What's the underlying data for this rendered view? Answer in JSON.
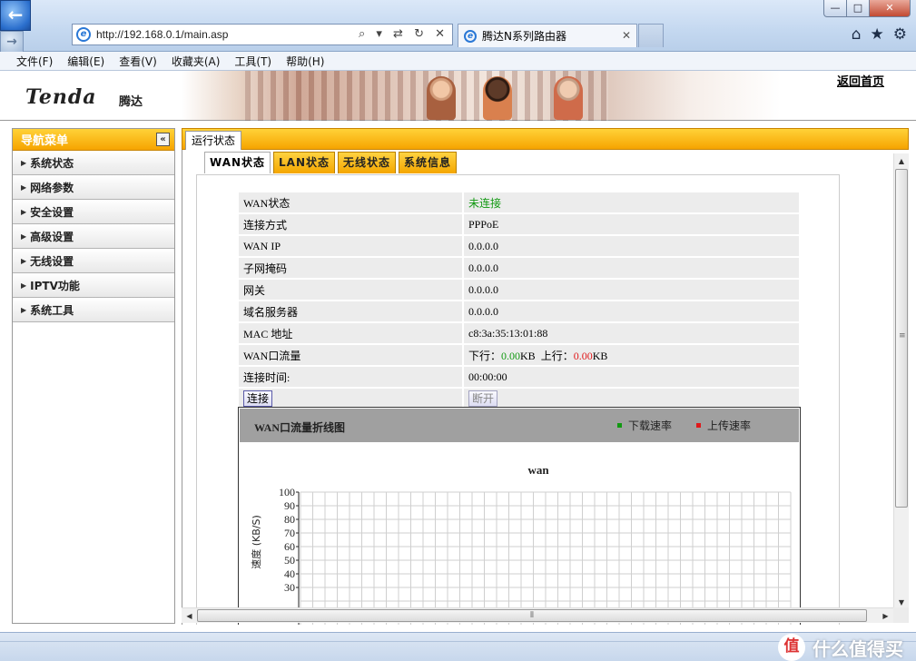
{
  "window": {
    "minimize": "—",
    "maximize": "□",
    "close": "✕"
  },
  "browser": {
    "url": "http://192.168.0.1/main.asp",
    "address_tools": "⌕ ▾ ⇄ ↻ ✕",
    "tab_title": "腾达N系列路由器",
    "tab_close": "✕",
    "menu": [
      "文件(F)",
      "编辑(E)",
      "查看(V)",
      "收藏夹(A)",
      "工具(T)",
      "帮助(H)"
    ],
    "icons": [
      "home-icon",
      "favorites-star-icon",
      "tools-gear-icon"
    ]
  },
  "banner": {
    "brand": "Tenda",
    "brand_cn": "腾达",
    "home_link": "返回首页"
  },
  "leftnav": {
    "title": "导航菜单",
    "collapse": "«",
    "items": [
      {
        "label": "系统状态"
      },
      {
        "label": "网络参数"
      },
      {
        "label": "安全设置"
      },
      {
        "label": "高级设置"
      },
      {
        "label": "无线设置"
      },
      {
        "label": "IPTV功能"
      },
      {
        "label": "系统工具"
      }
    ]
  },
  "main": {
    "tab": "运行状态",
    "subtabs": [
      "WAN状态",
      "LAN状态",
      "无线状态",
      "系统信息"
    ],
    "active_subtab": "WAN状态"
  },
  "wan": {
    "status_label": "WAN状态",
    "status_value": "未连接",
    "conn_type_label": "连接方式",
    "conn_type_value": "PPPoE",
    "ip_label": "WAN IP",
    "ip_value": "0.0.0.0",
    "mask_label": "子网掩码",
    "mask_value": "0.0.0.0",
    "gateway_label": "网关",
    "gateway_value": "0.0.0.0",
    "dns_label": "域名服务器",
    "dns_value": "0.0.0.0",
    "mac_label": "MAC 地址",
    "mac_value": "c8:3a:35:13:01:88",
    "traffic_label": "WAN口流量",
    "down_label": "下行：",
    "down_value": "0.00",
    "down_unit": "KB",
    "up_label": "上行：",
    "up_value": "0.00",
    "up_unit": "KB",
    "uptime_label": "连接时间:",
    "uptime_value": "00:00:00",
    "connect_button": "连接",
    "disconnect_button": "断开"
  },
  "colors": {
    "accent": "#f6a400",
    "download": "#119911",
    "upload": "#e0181a"
  },
  "chart_data": {
    "type": "line",
    "panel_title": "WAN口流量折线图",
    "title": "wan",
    "ylabel": "速度 (KB/S)",
    "xlabel": "",
    "ylim": [
      0,
      100
    ],
    "yticks": [
      "100",
      "90",
      "80",
      "70",
      "60",
      "50",
      "40",
      "30"
    ],
    "grid": true,
    "legend_position": "top-right",
    "series": [
      {
        "name": "下载速率",
        "color": "#119911",
        "values": []
      },
      {
        "name": "上传速率",
        "color": "#e0181a",
        "values": []
      }
    ]
  }
}
